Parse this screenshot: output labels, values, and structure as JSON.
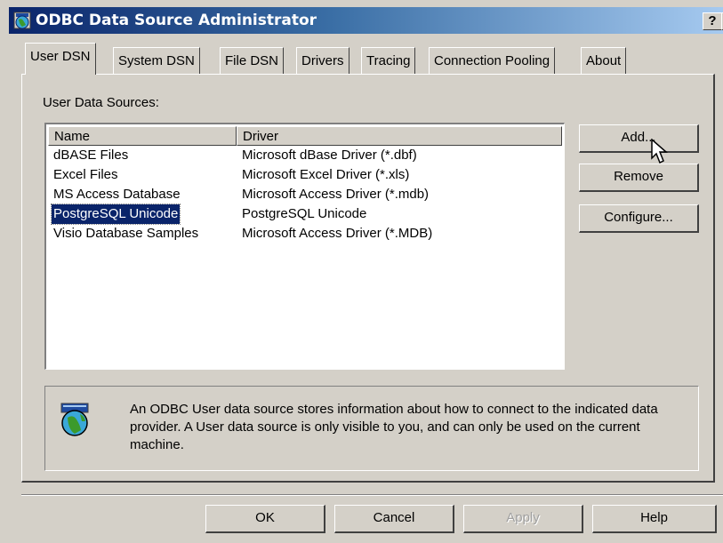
{
  "window": {
    "title": "ODBC Data Source Administrator",
    "help_button": "?",
    "close_button": "×"
  },
  "tabs": [
    {
      "label": "User DSN",
      "active": true
    },
    {
      "label": "System DSN",
      "active": false
    },
    {
      "label": "File DSN",
      "active": false
    },
    {
      "label": "Drivers",
      "active": false
    },
    {
      "label": "Tracing",
      "active": false
    },
    {
      "label": "Connection Pooling",
      "active": false
    },
    {
      "label": "About",
      "active": false
    }
  ],
  "user_dsn": {
    "section_label": "User Data Sources:",
    "columns": {
      "name": "Name",
      "driver": "Driver"
    },
    "rows": [
      {
        "name": "dBASE Files",
        "driver": "Microsoft dBase Driver (*.dbf)",
        "selected": false
      },
      {
        "name": "Excel Files",
        "driver": "Microsoft Excel Driver (*.xls)",
        "selected": false
      },
      {
        "name": "MS Access Database",
        "driver": "Microsoft Access Driver (*.mdb)",
        "selected": false
      },
      {
        "name": "PostgreSQL Unicode",
        "driver": "PostgreSQL Unicode",
        "selected": true
      },
      {
        "name": "Visio Database Samples",
        "driver": "Microsoft Access Driver (*.MDB)",
        "selected": false
      }
    ],
    "buttons": {
      "add": "Add...",
      "remove": "Remove",
      "configure": "Configure..."
    },
    "info_text": "An ODBC User data source stores information about how to connect to the indicated data provider.  A User data source is only visible to you, and can only be used on the current machine."
  },
  "footer": {
    "ok": "OK",
    "cancel": "Cancel",
    "apply": "Apply",
    "help": "Help"
  },
  "colors": {
    "titlebar_start": "#0a246a",
    "titlebar_end": "#a6caf0",
    "face": "#d4d0c8",
    "selection": "#0a246a"
  },
  "icons": [
    "odbc-globe-icon",
    "mouse-pointer-icon"
  ]
}
